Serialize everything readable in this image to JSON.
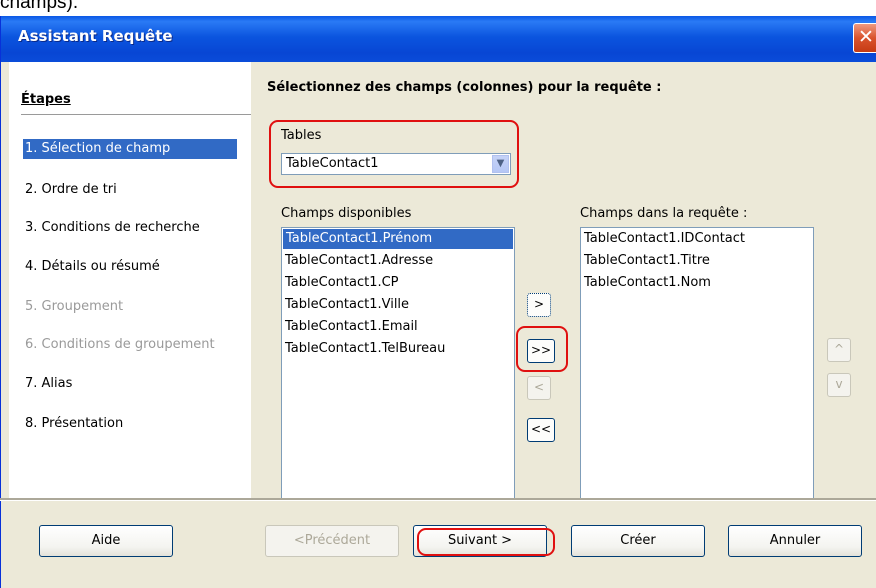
{
  "caption_fragment": "champs).",
  "window": {
    "title": "Assistant Requête",
    "close": "✕"
  },
  "steps": {
    "title": "Étapes",
    "items": [
      {
        "label": "1.  Sélection de champ",
        "state": "selected"
      },
      {
        "label": "2.  Ordre de tri",
        "state": "normal"
      },
      {
        "label": "3.  Conditions de recherche",
        "state": "normal"
      },
      {
        "label": "4.  Détails ou résumé",
        "state": "normal"
      },
      {
        "label": "5.  Groupement",
        "state": "disabled"
      },
      {
        "label": "6.  Conditions de groupement",
        "state": "disabled"
      },
      {
        "label": "7.  Alias",
        "state": "normal"
      },
      {
        "label": "8.  Présentation",
        "state": "normal"
      }
    ]
  },
  "main": {
    "heading": "Sélectionnez des champs (colonnes) pour la requête :",
    "tables_label": "Tables",
    "tables_value": "TableContact1",
    "available_label": "Champs disponibles",
    "available_fields": [
      "TableContact1.Prénom",
      "TableContact1.Adresse",
      "TableContact1.CP",
      "TableContact1.Ville",
      "TableContact1.Email",
      "TableContact1.TelBureau"
    ],
    "selected_label": "Champs dans la requête :",
    "selected_fields": [
      "TableContact1.IDContact",
      "TableContact1.Titre",
      "TableContact1.Nom"
    ],
    "move_buttons": {
      "add_one": ">",
      "add_all": ">>",
      "remove_one": "<",
      "remove_all": "<<"
    },
    "order_buttons": {
      "up": "^",
      "down": "v"
    }
  },
  "footer": {
    "help": "Aide",
    "previous": "<Précédent",
    "next": "Suivant >",
    "create": "Créer",
    "cancel": "Annuler"
  },
  "colors": {
    "titlebar": "#0a4cd9",
    "selection": "#316ac5",
    "highlight_ring": "#e01010",
    "dialog_bg": "#ece9d8"
  }
}
